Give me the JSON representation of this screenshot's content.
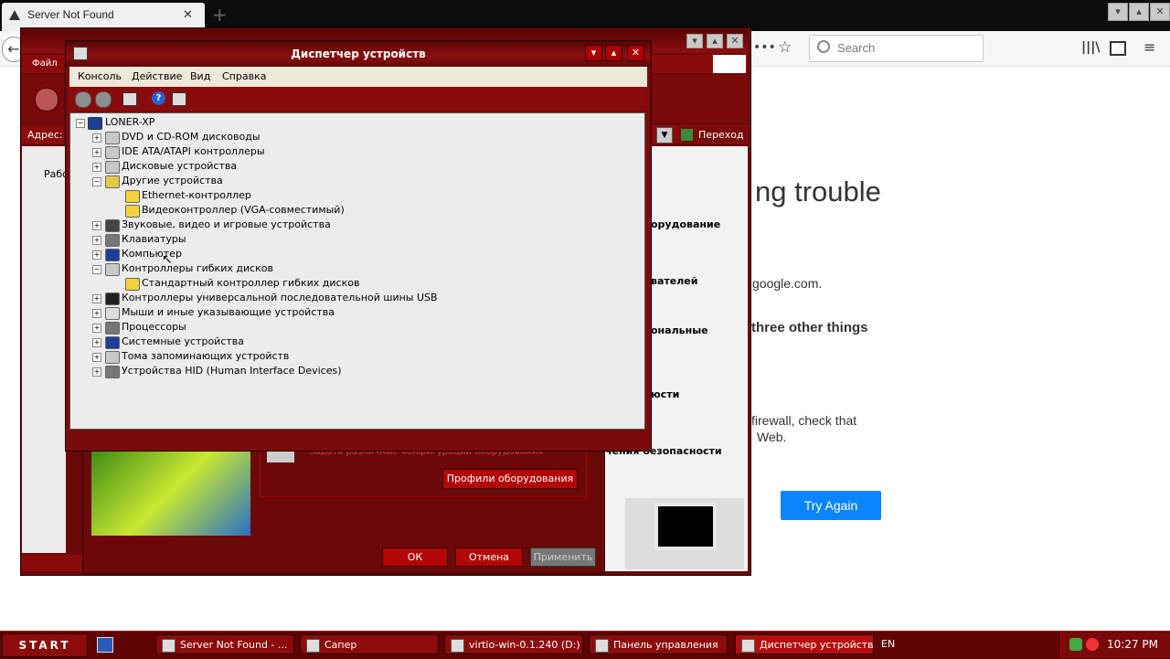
{
  "firefox": {
    "tab_title": "Server Not Found",
    "tab_close": "✕",
    "new_tab": "+",
    "search_placeholder": "Search",
    "page_title": "ng trouble",
    "line1": "google.com.",
    "line2": "three other things",
    "line3a": "firewall, check that",
    "line3b": "Web.",
    "try_again": "Try Again"
  },
  "control_panel": {
    "menu_file": "Файл",
    "address_label": "Адрес:",
    "go_label": "Переход",
    "sidebar_frag": "Рабо",
    "right_col": [
      "орудование",
      "вателей",
      "ональные",
      "юсти",
      "чения безопасности"
    ],
    "hw_profiles_text": "Задать различные конфигурации оборудования",
    "hw_profiles_button": "Профили оборудования",
    "ok": "ОК",
    "cancel": "Отмена",
    "apply": "Применить"
  },
  "device_manager": {
    "title": "Диспетчер устройств",
    "menu": [
      "Консоль",
      "Действие",
      "Вид",
      "Справка"
    ],
    "root": "LONER-XP",
    "tree": [
      {
        "label": "DVD и CD-ROM дисководы",
        "level": 1,
        "exp": "+",
        "icon": "cdrom-icon",
        "color": "#c8c8c8"
      },
      {
        "label": "IDE ATA/ATAPI контроллеры",
        "level": 1,
        "exp": "+",
        "icon": "ide-controller-icon",
        "color": "#c8c8c8"
      },
      {
        "label": "Дисковые устройства",
        "level": 1,
        "exp": "+",
        "icon": "disk-drive-icon",
        "color": "#c8c8c8"
      },
      {
        "label": "Другие устройства",
        "level": 1,
        "exp": "-",
        "icon": "unknown-device-icon",
        "color": "#e6c84a"
      },
      {
        "label": "Ethernet-контроллер",
        "level": 2,
        "exp": "",
        "icon": "warning-icon",
        "color": "#f3d23c"
      },
      {
        "label": "Видеоконтроллер (VGA-совместимый)",
        "level": 2,
        "exp": "",
        "icon": "warning-icon",
        "color": "#f3d23c"
      },
      {
        "label": "Звуковые, видео и игровые устройства",
        "level": 1,
        "exp": "+",
        "icon": "sound-icon",
        "color": "#444"
      },
      {
        "label": "Клавиатуры",
        "level": 1,
        "exp": "+",
        "icon": "keyboard-icon",
        "color": "#777"
      },
      {
        "label": "Компьютер",
        "level": 1,
        "exp": "+",
        "icon": "computer-icon",
        "color": "#1d3f9a"
      },
      {
        "label": "Контроллеры гибких дисков",
        "level": 1,
        "exp": "-",
        "icon": "floppy-controller-icon",
        "color": "#c8c8c8"
      },
      {
        "label": "Стандартный контроллер гибких дисков",
        "level": 2,
        "exp": "",
        "icon": "warning-icon",
        "color": "#f3d23c"
      },
      {
        "label": "Контроллеры универсальной последовательной шины USB",
        "level": 1,
        "exp": "+",
        "icon": "usb-icon",
        "color": "#222"
      },
      {
        "label": "Мыши и иные указывающие устройства",
        "level": 1,
        "exp": "+",
        "icon": "mouse-icon",
        "color": "#ddd"
      },
      {
        "label": "Процессоры",
        "level": 1,
        "exp": "+",
        "icon": "processor-icon",
        "color": "#777"
      },
      {
        "label": "Системные устройства",
        "level": 1,
        "exp": "+",
        "icon": "system-device-icon",
        "color": "#1d3f9a"
      },
      {
        "label": "Тома запоминающих устройств",
        "level": 1,
        "exp": "+",
        "icon": "storage-volume-icon",
        "color": "#c8c8c8"
      },
      {
        "label": "Устройства HID (Human Interface Devices)",
        "level": 1,
        "exp": "+",
        "icon": "hid-icon",
        "color": "#777"
      }
    ]
  },
  "taskbar": {
    "start": "START",
    "items": [
      "Server Not Found - ...",
      "Сапер",
      "virtio-win-0.1.240 (D:)",
      "Панель управления",
      "Диспетчер устройств"
    ],
    "lang": "EN",
    "clock": "10:27 PM"
  }
}
